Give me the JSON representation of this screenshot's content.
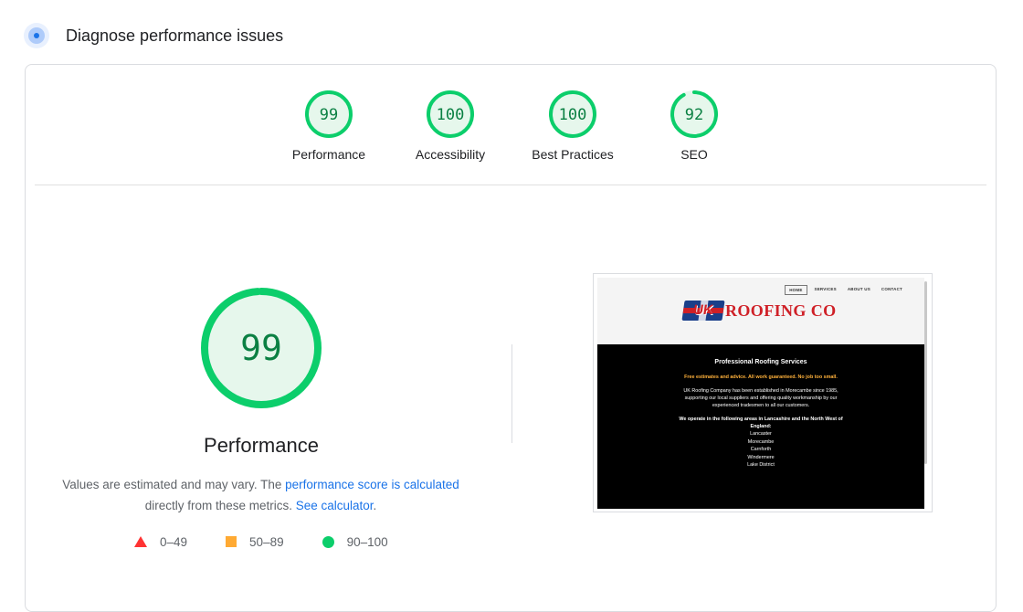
{
  "header": {
    "title": "Diagnose performance issues",
    "icon": "lighthouse-icon"
  },
  "colors": {
    "pass": "#0cce6b",
    "pass_bg": "#e6f7ec",
    "pass_text": "#0b8043",
    "average": "#ffaa33",
    "fail": "#ff3333",
    "link": "#1a73e8"
  },
  "gauges": [
    {
      "label": "Performance",
      "score": "99",
      "value": 99
    },
    {
      "label": "Accessibility",
      "score": "100",
      "value": 100
    },
    {
      "label": "Best Practices",
      "score": "100",
      "value": 100
    },
    {
      "label": "SEO",
      "score": "92",
      "value": 92
    }
  ],
  "performance": {
    "score": "99",
    "value": 99,
    "title": "Performance",
    "desc_prefix": "Values are estimated and may vary. The ",
    "desc_link1": "performance score is calculated",
    "desc_middle": " directly from these metrics. ",
    "desc_link2": "See calculator",
    "desc_suffix": "."
  },
  "legend": [
    {
      "shape": "triangle",
      "range": "0–49"
    },
    {
      "shape": "square",
      "range": "50–89"
    },
    {
      "shape": "circle",
      "range": "90–100"
    }
  ],
  "screenshot": {
    "nav": [
      "HOME",
      "SERVICES",
      "ABOUT US",
      "CONTACT"
    ],
    "logo_flag": "UK",
    "logo_text": "ROOFING CO",
    "heading": "Professional Roofing Services",
    "offer": "Free estimates and advice. All work guaranteed. No job too small.",
    "para1": "UK Roofing Company has been established in Morecambe since 1985, supporting our local suppliers and offering quality workmanship by our experienced tradesmen to all our customers.",
    "areas_heading": "We operate in the following areas in Lancashire and the North West of England:",
    "areas": [
      "Lancaster",
      "Morecambe",
      "Carnforth",
      "Windermere",
      "Lake District"
    ]
  }
}
